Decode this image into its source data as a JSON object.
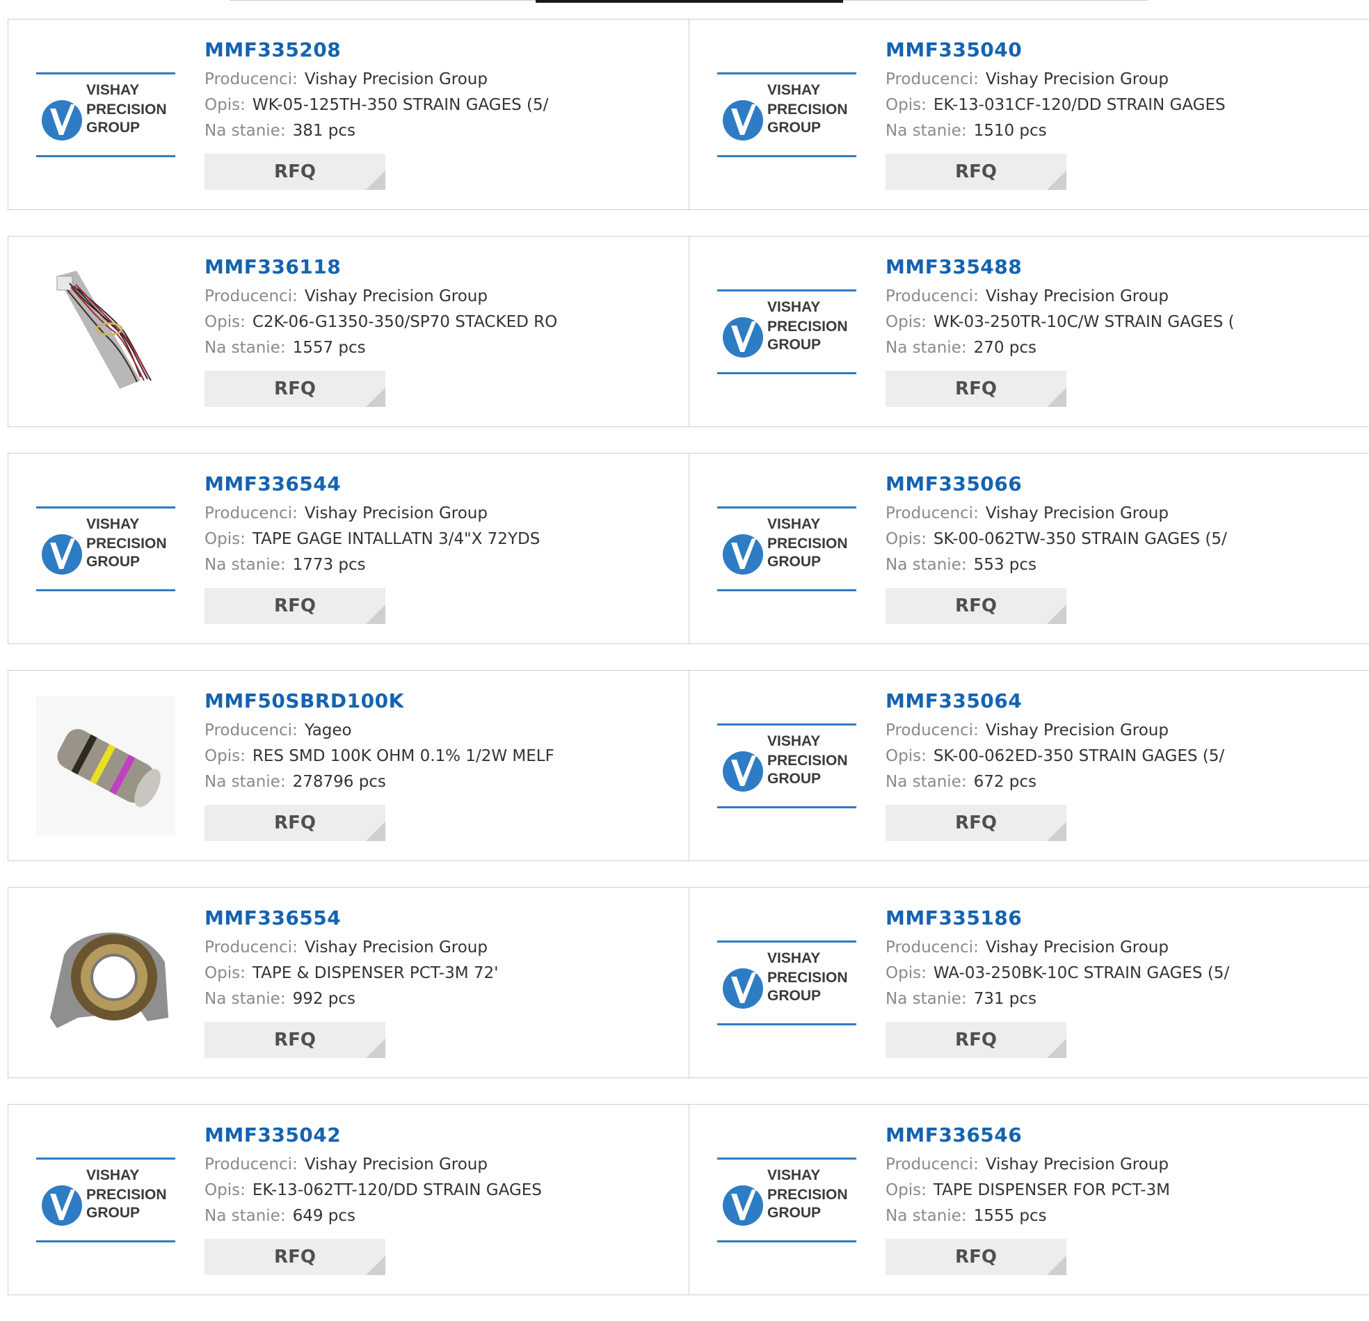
{
  "labels": {
    "manufacturer": "Producenci:",
    "description": "Opis:",
    "stock": "Na stanie:",
    "rfq": "RFQ"
  },
  "logo_words": [
    "VISHAY",
    "PRECISION",
    "GROUP"
  ],
  "colors": {
    "part_number": "#1463b1",
    "logo_blue": "#2e7cc4"
  },
  "products": [
    {
      "pn": "MMF335208",
      "manufacturer": "Vishay Precision Group",
      "description": "WK-05-125TH-350 STRAIN GAGES (5/",
      "stock": "381 pcs",
      "image": "vishay-logo"
    },
    {
      "pn": "MMF335040",
      "manufacturer": "Vishay Precision Group",
      "description": "EK-13-031CF-120/DD STRAIN GAGES",
      "stock": "1510 pcs",
      "image": "vishay-logo"
    },
    {
      "pn": "MMF336118",
      "manufacturer": "Vishay Precision Group",
      "description": "C2K-06-G1350-350/SP70 STACKED RO",
      "stock": "1557 pcs",
      "image": "wired-gage-photo"
    },
    {
      "pn": "MMF335488",
      "manufacturer": "Vishay Precision Group",
      "description": "WK-03-250TR-10C/W STRAIN GAGES (",
      "stock": "270 pcs",
      "image": "vishay-logo"
    },
    {
      "pn": "MMF336544",
      "manufacturer": "Vishay Precision Group",
      "description": "TAPE GAGE INTALLATN 3/4\"X 72YDS",
      "stock": "1773 pcs",
      "image": "vishay-logo"
    },
    {
      "pn": "MMF335066",
      "manufacturer": "Vishay Precision Group",
      "description": "SK-00-062TW-350 STRAIN GAGES (5/",
      "stock": "553 pcs",
      "image": "vishay-logo"
    },
    {
      "pn": "MMF50SBRD100K",
      "manufacturer": "Yageo",
      "description": "RES SMD 100K OHM 0.1% 1/2W MELF",
      "stock": "278796 pcs",
      "image": "melf-resistor-photo"
    },
    {
      "pn": "MMF335064",
      "manufacturer": "Vishay Precision Group",
      "description": "SK-00-062ED-350 STRAIN GAGES (5/",
      "stock": "672 pcs",
      "image": "vishay-logo"
    },
    {
      "pn": "MMF336554",
      "manufacturer": "Vishay Precision Group",
      "description": "TAPE & DISPENSER PCT-3M 72'",
      "stock": "992 pcs",
      "image": "tape-dispenser-photo"
    },
    {
      "pn": "MMF335186",
      "manufacturer": "Vishay Precision Group",
      "description": "WA-03-250BK-10C STRAIN GAGES (5/",
      "stock": "731 pcs",
      "image": "vishay-logo"
    },
    {
      "pn": "MMF335042",
      "manufacturer": "Vishay Precision Group",
      "description": "EK-13-062TT-120/DD STRAIN GAGES",
      "stock": "649 pcs",
      "image": "vishay-logo"
    },
    {
      "pn": "MMF336546",
      "manufacturer": "Vishay Precision Group",
      "description": "TAPE DISPENSER FOR PCT-3M",
      "stock": "1555 pcs",
      "image": "vishay-logo"
    }
  ]
}
